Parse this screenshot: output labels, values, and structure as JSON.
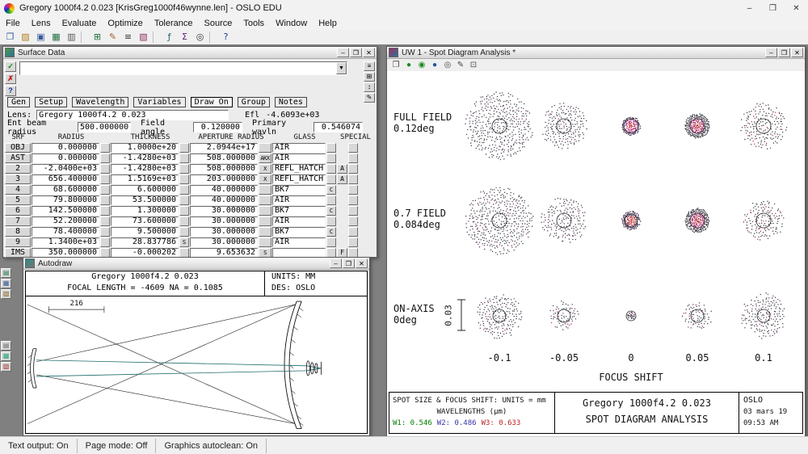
{
  "window": {
    "title": "Gregory 1000f4.2 0.023 [KrisGreg1000f46wynne.len] - OSLO EDU",
    "menus": [
      "File",
      "Lens",
      "Evaluate",
      "Optimize",
      "Tolerance",
      "Source",
      "Tools",
      "Window",
      "Help"
    ],
    "chrome": {
      "minimize": "–",
      "maximize": "❒",
      "close": "✕"
    },
    "toolbar": [
      {
        "name": "new-lens-icon",
        "glyph": "❐",
        "color": "#345a9a"
      },
      {
        "name": "open-lens-icon",
        "glyph": "▨",
        "color": "#b08020"
      },
      {
        "name": "save-lens-icon",
        "glyph": "▣",
        "color": "#345a9a"
      },
      {
        "name": "lens-catalog-icon",
        "glyph": "▦",
        "color": "#207040"
      },
      {
        "name": "print-icon",
        "glyph": "▥",
        "color": "#555555"
      },
      {
        "sep": true
      },
      {
        "name": "surface-data-spreadsheet-icon",
        "glyph": "⊞",
        "color": "#207040"
      },
      {
        "name": "autodraw-icon",
        "glyph": "✎",
        "color": "#a06020"
      },
      {
        "name": "text-output-icon",
        "glyph": "≡",
        "color": "#333333"
      },
      {
        "name": "graphics-window-icon",
        "glyph": "▧",
        "color": "#8a3060"
      },
      {
        "sep": true
      },
      {
        "name": "evaluate-icon",
        "glyph": "ƒ",
        "color": "#206070"
      },
      {
        "name": "optimize-icon",
        "glyph": "Σ",
        "color": "#602080"
      },
      {
        "name": "slider-wheel-icon",
        "glyph": "◎",
        "color": "#333333"
      },
      {
        "sep": true
      },
      {
        "name": "help-icon",
        "glyph": "?",
        "color": "#2040a0"
      }
    ],
    "dock_groups": [
      [
        {
          "name": "docked-text-window-icon",
          "glyph": "▤",
          "color": "#207040"
        },
        {
          "name": "docked-graphics-window-icon",
          "glyph": "▦",
          "color": "#345a9a"
        },
        {
          "name": "docked-sheet-window-icon",
          "glyph": "▧",
          "color": "#8a6020"
        }
      ],
      [
        {
          "name": "docked-window-icon-a",
          "glyph": "▤",
          "color": "#666666"
        },
        {
          "name": "docked-window-icon-b",
          "glyph": "▦",
          "color": "#22aa77"
        },
        {
          "name": "docked-window-icon-c",
          "glyph": "▧",
          "color": "#aa3333"
        }
      ]
    ],
    "status": [
      "Text output: On",
      "Page mode: Off",
      "Graphics autoclean: On"
    ]
  },
  "surface_window": {
    "title": "Surface Data",
    "action_icons": [
      {
        "name": "apply-icon",
        "glyph": "✓",
        "color": "#0a8a0a"
      },
      {
        "name": "revert-icon",
        "glyph": "✗",
        "color": "#c01010"
      },
      {
        "name": "help-icon",
        "glyph": "?",
        "color": "#1030a0"
      }
    ],
    "sheet_tools": [
      {
        "name": "sheet-tool-rows-icon",
        "glyph": "≡"
      },
      {
        "name": "sheet-tool-insert-icon",
        "glyph": "⊞"
      },
      {
        "name": "sheet-tool-move-icon",
        "glyph": "↕"
      },
      {
        "name": "sheet-tool-edit-icon",
        "glyph": "✎"
      }
    ],
    "command_value": "",
    "tabs": [
      "Gen",
      "Setup",
      "Wavelength",
      "Variables",
      "Draw On",
      "Group",
      "Notes"
    ],
    "active_tab": "Draw On",
    "lens_label": "Lens:",
    "lens_name": "Gregory 1000f4.2 0.023",
    "efl_label": "Efl",
    "efl_value": "-4.6093e+03",
    "info_line": [
      {
        "label": "Ent beam radius",
        "value": "500.000000"
      },
      {
        "label": "Field angle",
        "value": "0.120000"
      },
      {
        "label": "Primary wavln",
        "value": "0.546074"
      }
    ],
    "columns": [
      "SRF",
      "RADIUS",
      "THICKNESS",
      "APERTURE RADIUS",
      "GLASS",
      "SPECIAL"
    ],
    "rows": [
      {
        "srf": "OBJ",
        "radius": "0.000000",
        "thickness": "1.0000e+20",
        "aperture": "2.0944e+17",
        "glass": "AIR"
      },
      {
        "srf": "AST",
        "radius": "0.000000",
        "thickness": "-1.4280e+03",
        "aperture": "508.000000",
        "ap_flag": "AKX",
        "glass": "AIR"
      },
      {
        "srf": "2",
        "radius": "-2.0400e+03",
        "thickness": "-1.4280e+03",
        "aperture": "508.000000",
        "ap_flag": "X",
        "glass": "REFL_HATCH",
        "special": "A"
      },
      {
        "srf": "3",
        "radius": "656.400000",
        "thickness": "1.5169e+03",
        "aperture": "203.000000",
        "ap_flag": "X",
        "glass": "REFL_HATCH",
        "special": "A"
      },
      {
        "srf": "4",
        "radius": "68.600000",
        "thickness": "6.600000",
        "aperture": "40.000000",
        "glass": "BK7",
        "glass_flag": "C"
      },
      {
        "srf": "5",
        "radius": "79.800000",
        "thickness": "53.500000",
        "aperture": "40.000000",
        "glass": "AIR"
      },
      {
        "srf": "6",
        "radius": "142.500000",
        "thickness": "1.300000",
        "aperture": "30.000000",
        "glass": "BK7",
        "glass_flag": "C"
      },
      {
        "srf": "7",
        "radius": "52.200000",
        "thickness": "73.600000",
        "aperture": "30.000000",
        "glass": "AIR"
      },
      {
        "srf": "8",
        "radius": "78.400000",
        "thickness": "9.500000",
        "aperture": "30.000000",
        "glass": "BK7",
        "glass_flag": "C"
      },
      {
        "srf": "9",
        "radius": "1.3400e+03",
        "thickness": "28.837786",
        "th_flag": "S",
        "aperture": "30.000000",
        "glass": "AIR"
      },
      {
        "srf": "IMS",
        "radius": "350.000000",
        "thickness": "-0.000202",
        "aperture": "9.653632",
        "ap_flag": "S",
        "glass": "",
        "special": "F"
      }
    ]
  },
  "autodraw_window": {
    "title": "Autodraw",
    "drawing_title": "Gregory 1000f4.2 0.023",
    "drawing_sub": "FOCAL LENGTH = -4609  NA = 0.1085",
    "units": "UNITS: MM",
    "des": "DES: OSLO",
    "dim_label": "216"
  },
  "spot_window": {
    "title": "UW 1 - Spot Diagram Analysis *",
    "toolbar": [
      {
        "name": "reset-window-icon",
        "glyph": "❐",
        "color": "#444444"
      },
      {
        "name": "update-plot-icon",
        "glyph": "●",
        "color": "#1a8a1a"
      },
      {
        "name": "update-all-icon",
        "glyph": "◉",
        "color": "#1a8a1a"
      },
      {
        "name": "plot-setup-icon",
        "glyph": "●",
        "color": "#2050a0"
      },
      {
        "name": "zoom-icon",
        "glyph": "◎",
        "color": "#444444"
      },
      {
        "name": "annotate-icon",
        "glyph": "✎",
        "color": "#444444"
      },
      {
        "name": "copy-graphics-icon",
        "glyph": "⊡",
        "color": "#444444"
      }
    ],
    "rows": [
      {
        "label": "FULL FIELD",
        "sublabel": "0.12deg"
      },
      {
        "label": "0.7 FIELD",
        "sublabel": "0.084deg"
      },
      {
        "label": "ON-AXIS",
        "sublabel": "0deg"
      }
    ],
    "scale_label": "0.03",
    "focus_shifts": [
      "-0.1",
      "-0.05",
      "0",
      "0.05",
      "0.1"
    ],
    "x_axis_label": "FOCUS SHIFT",
    "cells": [
      [
        {
          "r": 40,
          "den": "s",
          "circ": 9,
          "cols": [
            "#3a3a44",
            "#7a3468"
          ]
        },
        {
          "r": 26,
          "den": "s",
          "circ": 9,
          "cols": [
            "#3a3a44",
            "#7a3468"
          ]
        },
        {
          "r": 11,
          "den": "d",
          "circ": 9,
          "cols": [
            "#443050",
            "#a82880",
            "#c03038"
          ]
        },
        {
          "r": 15,
          "den": "d",
          "circ": 9,
          "cols": [
            "#3a3a44",
            "#a02878",
            "#b03048"
          ]
        },
        {
          "r": 26,
          "den": "s",
          "circ": 9,
          "cols": [
            "#3a3a44",
            "#a03050"
          ]
        }
      ],
      [
        {
          "r": 40,
          "den": "s",
          "circ": 9,
          "cols": [
            "#3a3a44",
            "#7a3468"
          ]
        },
        {
          "r": 26,
          "den": "s",
          "circ": 9,
          "cols": [
            "#3a3a44",
            "#7a3468"
          ]
        },
        {
          "r": 10,
          "den": "d",
          "circ": 8,
          "cols": [
            "#443050",
            "#b02830",
            "#c03038"
          ]
        },
        {
          "r": 15,
          "den": "d",
          "circ": 9,
          "cols": [
            "#3a3a44",
            "#a02878",
            "#b03048"
          ]
        },
        {
          "r": 25,
          "den": "s",
          "circ": 9,
          "cols": [
            "#3a3a44",
            "#a03050"
          ]
        }
      ],
      [
        {
          "r": 26,
          "den": "s",
          "circ": 8,
          "cols": [
            "#3a3a44",
            "#7a3468"
          ]
        },
        {
          "r": 16,
          "den": "s",
          "circ": 8,
          "cols": [
            "#3a3a44",
            "#a02878"
          ]
        },
        {
          "r": 4,
          "den": "d",
          "circ": 6,
          "cols": [
            "#3a3a44",
            "#803060"
          ]
        },
        {
          "r": 16,
          "den": "s",
          "circ": 8,
          "cols": [
            "#3a3a44",
            "#a02878"
          ]
        },
        {
          "r": 26,
          "den": "s",
          "circ": 8,
          "cols": [
            "#3a3a44",
            "#7a3468"
          ]
        }
      ]
    ],
    "footer": {
      "units_line": "SPOT SIZE & FOCUS SHIFT: UNITS = mm",
      "wavelengths_line": "WAVELENGTHS (μm)",
      "w": [
        {
          "name": "W1:",
          "value": "0.546",
          "color": "#008000"
        },
        {
          "name": "W2:",
          "value": "0.486",
          "color": "#3333aa"
        },
        {
          "name": "W3:",
          "value": "0.633",
          "color": "#bb2222"
        }
      ],
      "title1": "Gregory 1000f4.2 0.023",
      "title2": "SPOT DIAGRAM ANALYSIS",
      "org": "OSLO",
      "date": "03 mars 19",
      "time": "09:53 AM"
    }
  },
  "chart_data": {
    "type": "scatter",
    "title": "SPOT DIAGRAM ANALYSIS",
    "subtitle": "Gregory 1000f4.2 0.023",
    "x_label": "FOCUS SHIFT",
    "x_values_mm": [
      -0.1,
      -0.05,
      0,
      0.05,
      0.1
    ],
    "row_fields": [
      "FULL FIELD 0.12deg",
      "0.7 FIELD 0.084deg",
      "ON-AXIS 0deg"
    ],
    "scale_bar_mm": 0.03,
    "wavelengths_um": [
      0.546,
      0.486,
      0.633
    ],
    "relative_spot_radius_px": [
      [
        40,
        26,
        11,
        15,
        26
      ],
      [
        40,
        26,
        10,
        15,
        25
      ],
      [
        26,
        16,
        4,
        16,
        26
      ]
    ]
  }
}
